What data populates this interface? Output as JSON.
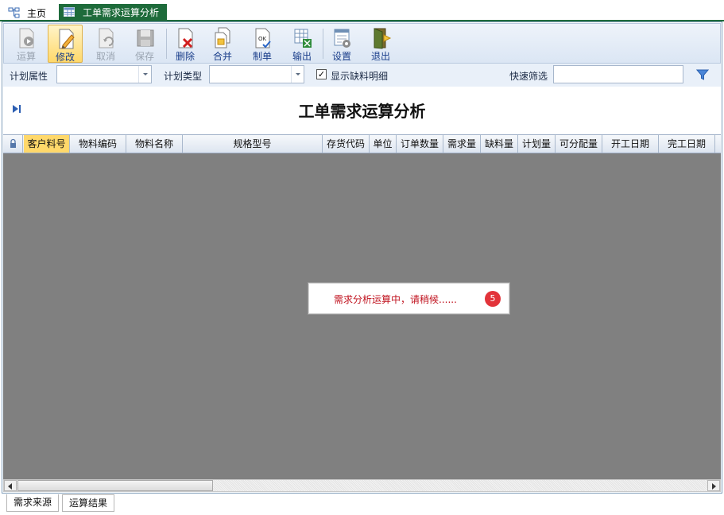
{
  "tabs": [
    {
      "label": "主页",
      "icon": "sitemap-icon"
    },
    {
      "label": "工单需求运算分析",
      "icon": "grid-icon",
      "active": true
    }
  ],
  "toolbar": {
    "buttons": [
      {
        "label": "运算",
        "icon": "calculate-icon",
        "state": "disabled"
      },
      {
        "label": "修改",
        "icon": "edit-icon",
        "state": "active"
      },
      {
        "label": "取消",
        "icon": "cancel-icon",
        "state": "disabled"
      },
      {
        "label": "保存",
        "icon": "save-icon",
        "state": "disabled"
      },
      {
        "label": "删除",
        "icon": "delete-icon",
        "state": "enabled"
      },
      {
        "label": "合并",
        "icon": "merge-icon",
        "state": "enabled"
      },
      {
        "label": "制单",
        "icon": "create-order-icon",
        "state": "enabled"
      },
      {
        "label": "输出",
        "icon": "export-excel-icon",
        "state": "enabled"
      },
      {
        "label": "设置",
        "icon": "settings-icon",
        "state": "enabled"
      },
      {
        "label": "退出",
        "icon": "exit-icon",
        "state": "enabled"
      }
    ]
  },
  "filters": {
    "plan_attr_label": "计划属性",
    "plan_attr_value": "",
    "plan_type_label": "计划类型",
    "plan_type_value": "",
    "show_shortage_label": "显示缺料明细",
    "show_shortage_checked": true,
    "check_mark": "✓",
    "quick_filter_label": "快速筛选",
    "quick_filter_value": ""
  },
  "page_title": "工单需求运算分析",
  "grid": {
    "columns": [
      "客户料号",
      "物料编码",
      "物料名称",
      "规格型号",
      "存货代码",
      "单位",
      "订单数量",
      "需求量",
      "缺料量",
      "计划量",
      "可分配量",
      "开工日期",
      "完工日期"
    ],
    "selected_column": "客户料号",
    "rows": []
  },
  "progress": {
    "message": "需求分析运算中，请稍候......",
    "counter": "5"
  },
  "bottom_tabs": [
    {
      "label": "需求来源",
      "active": true
    },
    {
      "label": "运算结果",
      "active": false
    }
  ],
  "colors": {
    "tab_active": "#1e6b3b",
    "grid_body": "#808080",
    "highlight": "#ffd86a",
    "progress_text": "#c0121e",
    "badge": "#e2333a"
  }
}
